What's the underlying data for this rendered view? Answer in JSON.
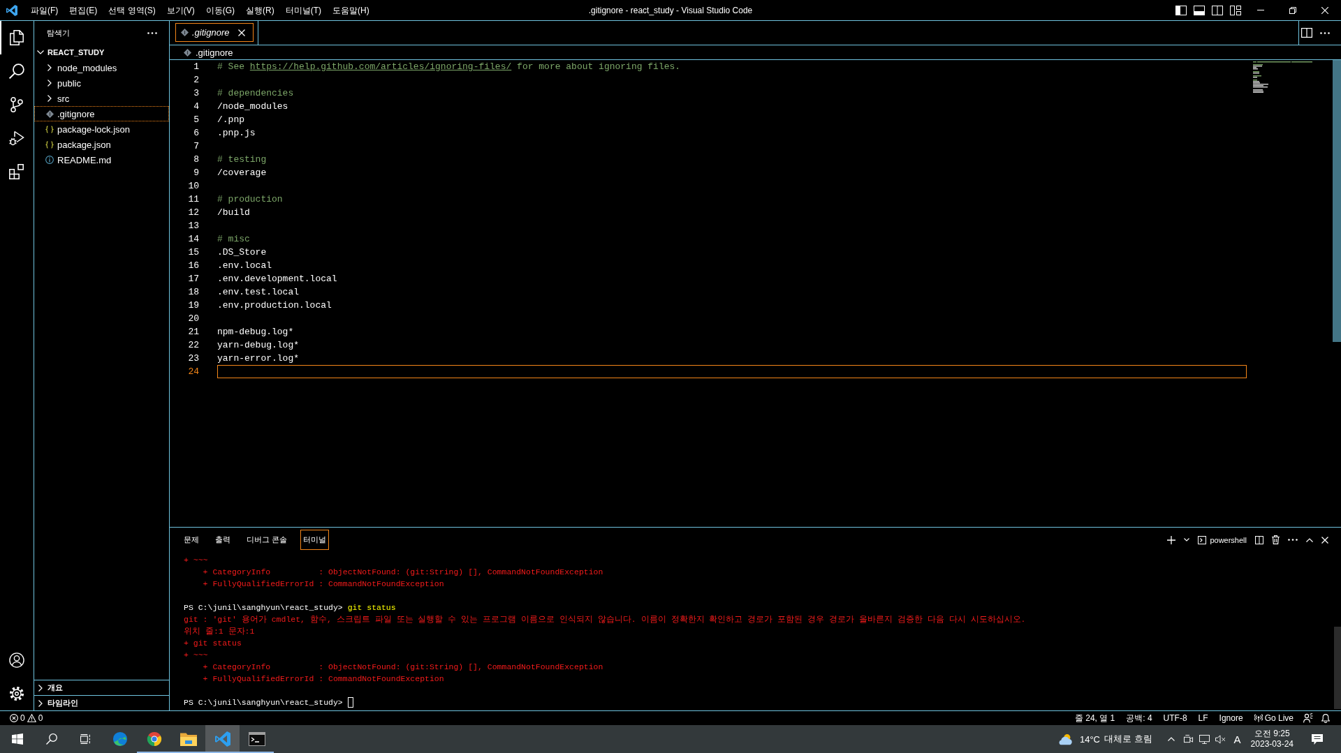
{
  "title_bar": {
    "menu": [
      "파일(F)",
      "편집(E)",
      "선택 영역(S)",
      "보기(V)",
      "이동(G)",
      "실행(R)",
      "터미널(T)",
      "도움말(H)"
    ],
    "title": ".gitignore - react_study - Visual Studio Code",
    "layout_toggles": [
      {
        "kind": "primary_sidebar",
        "on": true
      },
      {
        "kind": "panel",
        "on": true
      },
      {
        "kind": "secondary_sidebar",
        "on": false
      }
    ]
  },
  "activity_bar": {
    "items": [
      {
        "kind": "explorer",
        "selected": true
      },
      {
        "kind": "search",
        "selected": false
      },
      {
        "kind": "source_control",
        "selected": false
      },
      {
        "kind": "run_debug",
        "selected": false
      },
      {
        "kind": "extensions",
        "selected": false
      }
    ],
    "bottom": [
      {
        "kind": "account"
      },
      {
        "kind": "settings"
      }
    ]
  },
  "sidebar": {
    "title": "탐색기",
    "folder": {
      "name": "REACT_STUDY",
      "expanded": true
    },
    "items": [
      {
        "name": "node_modules",
        "kind": "folder",
        "expanded": false,
        "selected": false
      },
      {
        "name": "public",
        "kind": "folder",
        "expanded": false,
        "selected": false
      },
      {
        "name": "src",
        "kind": "folder",
        "expanded": false,
        "selected": false
      },
      {
        "name": ".gitignore",
        "kind": "gitignore",
        "selected": true
      },
      {
        "name": "package-lock.json",
        "kind": "json",
        "selected": false
      },
      {
        "name": "package.json",
        "kind": "json",
        "selected": false
      },
      {
        "name": "README.md",
        "kind": "info",
        "selected": false
      }
    ],
    "sections": [
      {
        "label": "개요",
        "expanded": false
      },
      {
        "label": "타임라인",
        "expanded": false
      }
    ]
  },
  "editor": {
    "tabs": [
      {
        "label": ".gitignore",
        "selected": true,
        "preview": true
      }
    ],
    "breadcrumb": ".gitignore",
    "lines": [
      {
        "number": "1",
        "current": false,
        "segments": [
          {
            "text": "# See ",
            "kind": "comment"
          },
          {
            "text": "https://help.github.com/articles/ignoring-files/",
            "kind": "link"
          },
          {
            "text": " for more about ignoring files.",
            "kind": "comment"
          }
        ]
      },
      {
        "number": "2",
        "current": false
      },
      {
        "number": "3",
        "current": false,
        "segments": [
          {
            "text": "# dependencies",
            "kind": "comment"
          }
        ]
      },
      {
        "number": "4",
        "current": false,
        "segments": [
          {
            "text": "/node_modules",
            "kind": "plain"
          }
        ]
      },
      {
        "number": "5",
        "current": false,
        "segments": [
          {
            "text": "/.pnp",
            "kind": "plain"
          }
        ]
      },
      {
        "number": "6",
        "current": false,
        "segments": [
          {
            "text": ".pnp.js",
            "kind": "plain"
          }
        ]
      },
      {
        "number": "7",
        "current": false
      },
      {
        "number": "8",
        "current": false,
        "segments": [
          {
            "text": "# testing",
            "kind": "comment"
          }
        ]
      },
      {
        "number": "9",
        "current": false,
        "segments": [
          {
            "text": "/coverage",
            "kind": "plain"
          }
        ]
      },
      {
        "number": "10",
        "current": false
      },
      {
        "number": "11",
        "current": false,
        "segments": [
          {
            "text": "# production",
            "kind": "comment"
          }
        ]
      },
      {
        "number": "12",
        "current": false,
        "segments": [
          {
            "text": "/build",
            "kind": "plain"
          }
        ]
      },
      {
        "number": "13",
        "current": false
      },
      {
        "number": "14",
        "current": false,
        "segments": [
          {
            "text": "# misc",
            "kind": "comment"
          }
        ]
      },
      {
        "number": "15",
        "current": false,
        "segments": [
          {
            "text": ".DS_Store",
            "kind": "plain"
          }
        ]
      },
      {
        "number": "16",
        "current": false,
        "segments": [
          {
            "text": ".env.local",
            "kind": "plain"
          }
        ]
      },
      {
        "number": "17",
        "current": false,
        "segments": [
          {
            "text": ".env.development.local",
            "kind": "plain"
          }
        ]
      },
      {
        "number": "18",
        "current": false,
        "segments": [
          {
            "text": ".env.test.local",
            "kind": "plain"
          }
        ]
      },
      {
        "number": "19",
        "current": false,
        "segments": [
          {
            "text": ".env.production.local",
            "kind": "plain"
          }
        ]
      },
      {
        "number": "20",
        "current": false
      },
      {
        "number": "21",
        "current": false,
        "segments": [
          {
            "text": "npm-debug.log*",
            "kind": "plain"
          }
        ]
      },
      {
        "number": "22",
        "current": false,
        "segments": [
          {
            "text": "yarn-debug.log*",
            "kind": "plain"
          }
        ]
      },
      {
        "number": "23",
        "current": false,
        "segments": [
          {
            "text": "yarn-error.log*",
            "kind": "plain"
          }
        ]
      },
      {
        "number": "24",
        "current": true
      }
    ]
  },
  "panel": {
    "tabs": [
      {
        "label": "문제",
        "selected": false
      },
      {
        "label": "출력",
        "selected": false
      },
      {
        "label": "디버그 콘솔",
        "selected": false
      },
      {
        "label": "터미널",
        "selected": true
      }
    ],
    "shell": "powershell",
    "terminal": {
      "lines": [
        {
          "kind": "output",
          "segments": [
            {
              "text": "+ ~~~",
              "kind": "error"
            }
          ]
        },
        {
          "kind": "output",
          "segments": [
            {
              "text": "    + CategoryInfo          : ObjectNotFound: (git:String) [], CommandNotFoundException",
              "kind": "error"
            }
          ]
        },
        {
          "kind": "output",
          "segments": [
            {
              "text": "    + FullyQualifiedErrorId : CommandNotFoundException",
              "kind": "error"
            }
          ]
        },
        {
          "kind": "blank"
        },
        {
          "kind": "output",
          "segments": [
            {
              "text": "PS C:\\junil\\sanghyun\\react_study> ",
              "kind": "prompt"
            },
            {
              "text": "git status",
              "kind": "command"
            }
          ]
        },
        {
          "kind": "output",
          "segments": [
            {
              "text": "git : 'git' 용어가 cmdlet, 함수, 스크립트 파일 또는 실행할 수 있는 프로그램 이름으로 인식되지 않습니다. 이름이 정확한지 확인하고 경로가 포함된 경우 경로가 올바른지 검증한 다음 다시 시도하십시오.",
              "kind": "error"
            }
          ]
        },
        {
          "kind": "output",
          "segments": [
            {
              "text": "위치 줄:1 문자:1",
              "kind": "error"
            }
          ]
        },
        {
          "kind": "output",
          "segments": [
            {
              "text": "+ git status",
              "kind": "error"
            }
          ]
        },
        {
          "kind": "output",
          "segments": [
            {
              "text": "+ ~~~",
              "kind": "error"
            }
          ]
        },
        {
          "kind": "output",
          "segments": [
            {
              "text": "    + CategoryInfo          : ObjectNotFound: (git:String) [], CommandNotFoundException",
              "kind": "error"
            }
          ]
        },
        {
          "kind": "output",
          "segments": [
            {
              "text": "    + FullyQualifiedErrorId : CommandNotFoundException",
              "kind": "error"
            }
          ]
        },
        {
          "kind": "blank"
        }
      ],
      "prompt": "PS C:\\junil\\sanghyun\\react_study> ",
      "cursor": true
    }
  },
  "status_bar": {
    "errors": "0",
    "warnings": "0",
    "items": [
      {
        "label": "줄 24, 열 1",
        "kind": "text"
      },
      {
        "label": "공백: 4",
        "kind": "text"
      },
      {
        "label": "UTF-8",
        "kind": "text"
      },
      {
        "label": "LF",
        "kind": "text"
      },
      {
        "label": "Ignore",
        "kind": "text"
      },
      {
        "label": "Go Live",
        "kind": "live"
      }
    ]
  },
  "taskbar": {
    "apps": [
      {
        "kind": "edge",
        "selected": false,
        "running": false
      },
      {
        "kind": "chrome",
        "selected": false,
        "running": true
      },
      {
        "kind": "explorer",
        "selected": false,
        "running": true
      },
      {
        "kind": "vscode",
        "selected": true,
        "running": true
      },
      {
        "kind": "terminal",
        "selected": false,
        "running": true
      }
    ],
    "weather": {
      "temperature": "14°C",
      "condition": "대체로 흐림"
    },
    "input_indicator": "A",
    "clock": {
      "time": "오전 9:25",
      "date": "2023-03-24"
    }
  }
}
